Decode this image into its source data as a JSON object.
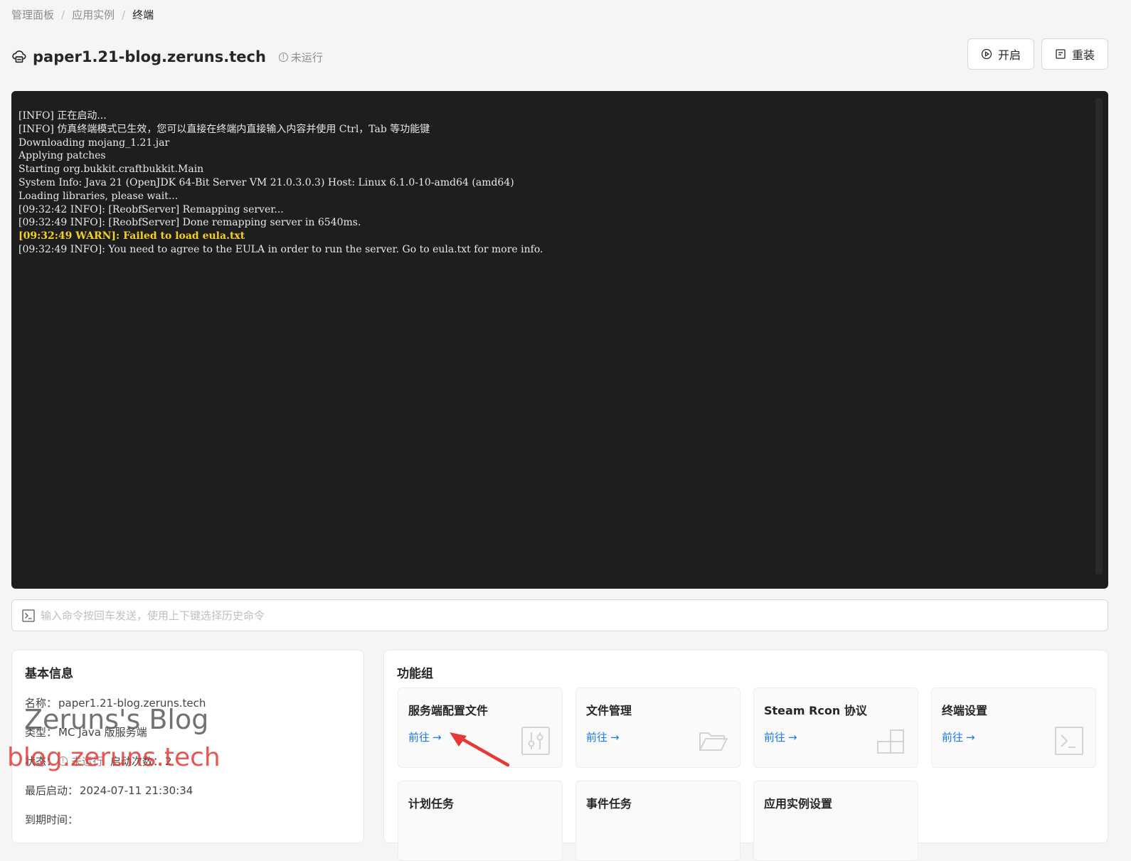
{
  "breadcrumb": {
    "items": [
      "管理面板",
      "应用实例",
      "终端"
    ]
  },
  "instance": {
    "title": "paper1.21-blog.zeruns.tech",
    "status_label": "未运行",
    "icon": "cloud-server-icon"
  },
  "actions": {
    "start_label": "开启",
    "reinstall_label": "重装"
  },
  "terminal": {
    "lines": [
      "[INFO] 正在启动...",
      "[INFO] 仿真终端模式已生效，您可以直接在终端内直接输入内容并使用 Ctrl，Tab 等功能键",
      "Downloading mojang_1.21.jar",
      "Applying patches",
      "Starting org.bukkit.craftbukkit.Main",
      "System Info: Java 21 (OpenJDK 64-Bit Server VM 21.0.3.0.3) Host: Linux 6.1.0-10-amd64 (amd64)",
      "Loading libraries, please wait...",
      "[09:32:42 INFO]: [ReobfServer] Remapping server...",
      "[09:32:49 INFO]: [ReobfServer] Done remapping server in 6540ms.",
      "[09:32:49 WARN]: Failed to load eula.txt",
      "[09:32:49 INFO]: You need to agree to the EULA in order to run the server. Go to eula.txt for more info."
    ],
    "warn_color": "#f5d020",
    "background": "#1e1e1e"
  },
  "command": {
    "placeholder": "输入命令按回车发送，使用上下键选择历史命令",
    "value": ""
  },
  "basic_info": {
    "title": "基本信息",
    "name_label": "名称：",
    "name_value": "paper1.21-blog.zeruns.tech",
    "type_label": "类型：",
    "type_value": "MC Java 版服务端",
    "status_label": "状态：",
    "status_value": "未运行",
    "start_count_label": "启动次数：",
    "start_count_value": "2",
    "last_start_label": "最后启动：",
    "last_start_value": "2024-07-11 21:30:34",
    "expire_label": "到期时间：",
    "expire_value": ""
  },
  "watermark": {
    "line1": "Zeruns's Blog",
    "line2": "blog.zeruns.tech"
  },
  "functions": {
    "title": "功能组",
    "go_label": "前往",
    "items": [
      {
        "name": "服务端配置文件",
        "icon": "sliders-icon"
      },
      {
        "name": "文件管理",
        "icon": "folder-open-icon"
      },
      {
        "name": "Steam Rcon 协议",
        "icon": "blocks-icon"
      },
      {
        "name": "终端设置",
        "icon": "terminal-icon"
      },
      {
        "name": "计划任务",
        "icon": ""
      },
      {
        "name": "事件任务",
        "icon": ""
      },
      {
        "name": "应用实例设置",
        "icon": ""
      }
    ]
  },
  "colors": {
    "accent": "#1677ff",
    "annotation_arrow": "#e53935"
  }
}
